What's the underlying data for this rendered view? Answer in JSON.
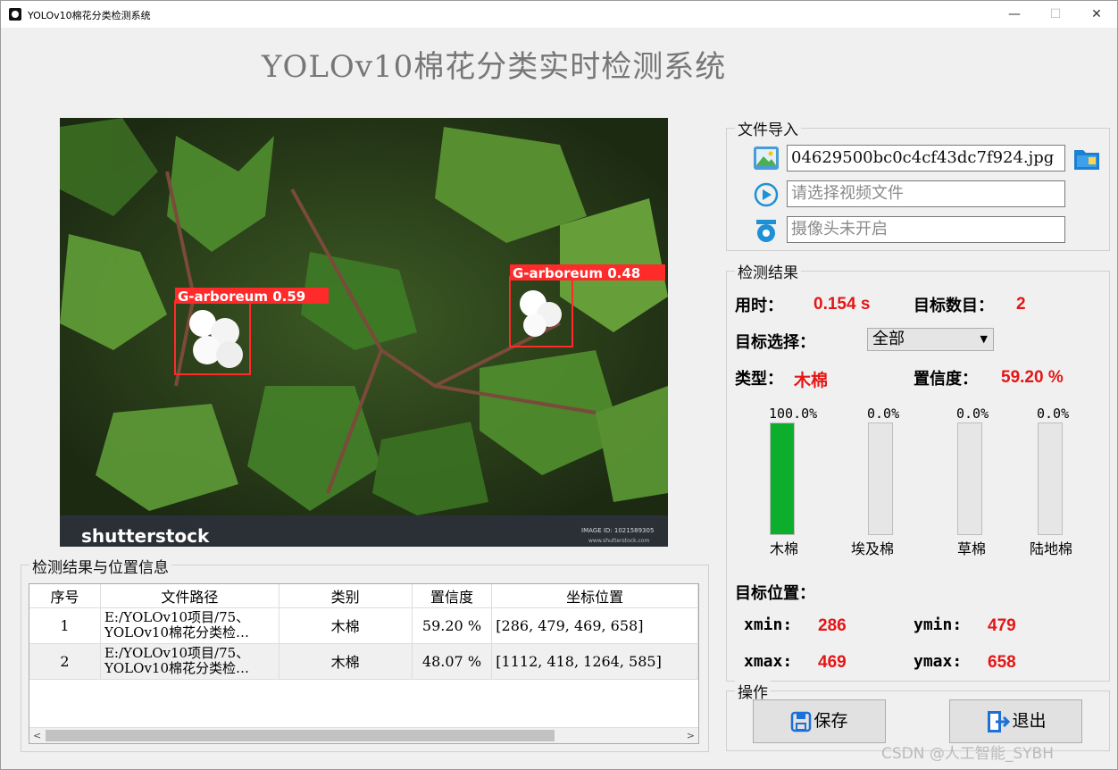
{
  "window": {
    "title": "YOLOv10棉花分类检测系统",
    "minimize": "—",
    "maximize": "☐",
    "close": "✕"
  },
  "heading": "YOLOv10棉花分类实时检测系统",
  "image": {
    "footer_brand": "shutterstock",
    "footer_id": "IMAGE ID: 1021589305",
    "footer_url": "www.shutterstock.com",
    "detections": [
      {
        "label": "G-arboreum 0.59"
      },
      {
        "label": "G-arboreum 0.48"
      }
    ]
  },
  "file_import": {
    "title": "文件导入",
    "image_value": "04629500bc0c4cf43dc7f924.jpg",
    "video_placeholder": "请选择视频文件",
    "camera_placeholder": "摄像头未开启"
  },
  "results": {
    "title": "检测结果",
    "time_label": "用时：",
    "time_value": "0.154 s",
    "count_label": "目标数目：",
    "count_value": "2",
    "select_label": "目标选择：",
    "select_value": "全部",
    "type_label": "类型：",
    "type_value": "木棉",
    "conf_label": "置信度：",
    "conf_value": "59.20 %",
    "bars": [
      {
        "label": "木棉",
        "pct_text": "100.0%",
        "value": 1.0
      },
      {
        "label": "埃及棉",
        "pct_text": "0.0%",
        "value": 0.0
      },
      {
        "label": "草棉",
        "pct_text": "0.0%",
        "value": 0.0
      },
      {
        "label": "陆地棉",
        "pct_text": "0.0%",
        "value": 0.0
      }
    ],
    "pos_label": "目标位置：",
    "xmin_label": "xmin:",
    "xmin": "286",
    "ymin_label": "ymin:",
    "ymin": "479",
    "xmax_label": "xmax:",
    "xmax": "469",
    "ymax_label": "ymax:",
    "ymax": "658"
  },
  "table": {
    "title": "检测结果与位置信息",
    "headers": [
      "序号",
      "文件路径",
      "类别",
      "置信度",
      "坐标位置"
    ],
    "rows": [
      {
        "idx": "1",
        "path1": "E:/YOLOv10项目/75、",
        "path2": "YOLOv10棉花分类检…",
        "cls": "木棉",
        "conf": "59.20 %",
        "coord": "[286, 479, 469, 658]"
      },
      {
        "idx": "2",
        "path1": "E:/YOLOv10项目/75、",
        "path2": "YOLOv10棉花分类检…",
        "cls": "木棉",
        "conf": "48.07 %",
        "coord": "[1112, 418, 1264, 585]"
      }
    ]
  },
  "ops": {
    "title": "操作",
    "save": "保存",
    "exit": "退出"
  },
  "watermark": "CSDN @人工智能_SYBH",
  "colors": {
    "accent_red": "#e51515",
    "bar_green": "#0cae2c",
    "box_red": "#ff2a2a"
  }
}
